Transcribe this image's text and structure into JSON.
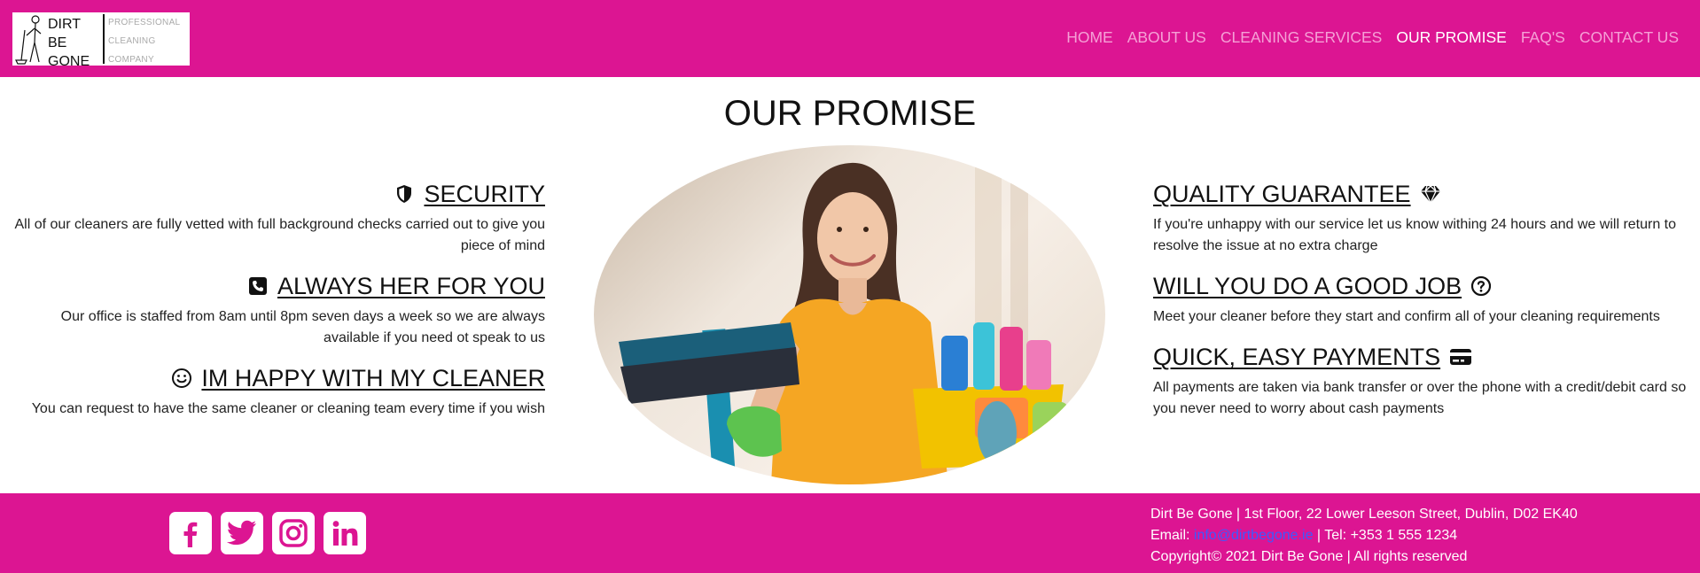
{
  "logo": {
    "main_lines": [
      "DIRT",
      "BE",
      "GONE"
    ],
    "sub_lines": [
      "PROFESSIONAL",
      "CLEANING",
      "COMPANY"
    ]
  },
  "nav": {
    "items": [
      {
        "label": "HOME",
        "active": false
      },
      {
        "label": "ABOUT US",
        "active": false
      },
      {
        "label": "CLEANING SERVICES",
        "active": false
      },
      {
        "label": "OUR PROMISE",
        "active": true
      },
      {
        "label": "FAQ'S",
        "active": false
      },
      {
        "label": "CONTACT US",
        "active": false
      }
    ]
  },
  "page": {
    "title": "OUR PROMISE"
  },
  "left": [
    {
      "icon": "shield-icon",
      "title": "SECURITY",
      "text": "All of our cleaners are fully vetted with full background checks carried out to give you piece of mind"
    },
    {
      "icon": "phone-icon",
      "title": "ALWAYS HER FOR YOU",
      "text": "Our office is staffed from 8am until 8pm seven days a week so we are always available if you need ot speak to us"
    },
    {
      "icon": "smile-icon",
      "title": "IM HAPPY WITH MY CLEANER",
      "text": "You can request to have the same cleaner or cleaning team every time if you wish"
    }
  ],
  "right": [
    {
      "icon": "diamond-icon",
      "title": "QUALITY GUARANTEE",
      "text": "If you're unhappy with our service let us know withing 24 hours and we will return to resolve the issue at no extra charge"
    },
    {
      "icon": "question-icon",
      "title": "WILL YOU DO A GOOD JOB",
      "text": "Meet your cleaner before they start and confirm all of your cleaning requirements"
    },
    {
      "icon": "credit-card-icon",
      "title": "QUICK, EASY PAYMENTS",
      "text": "All payments are taken via bank transfer or over the phone with a credit/debit card so you never need to worry about cash payments"
    }
  ],
  "footer": {
    "address": "Dirt Be Gone | 1st Floor, 22 Lower Leeson Street, Dublin, D02 EK40",
    "email_label": "Email: ",
    "email": "info@dirtbegone.ie",
    "tel": " | Tel: +353 1 555 1234",
    "copyright": "Copyright© 2021 Dirt Be Gone | All rights reserved"
  },
  "colors": {
    "brand": "#dc1592",
    "nav_inactive": "#f5a0d6",
    "link": "#3d5afe"
  }
}
